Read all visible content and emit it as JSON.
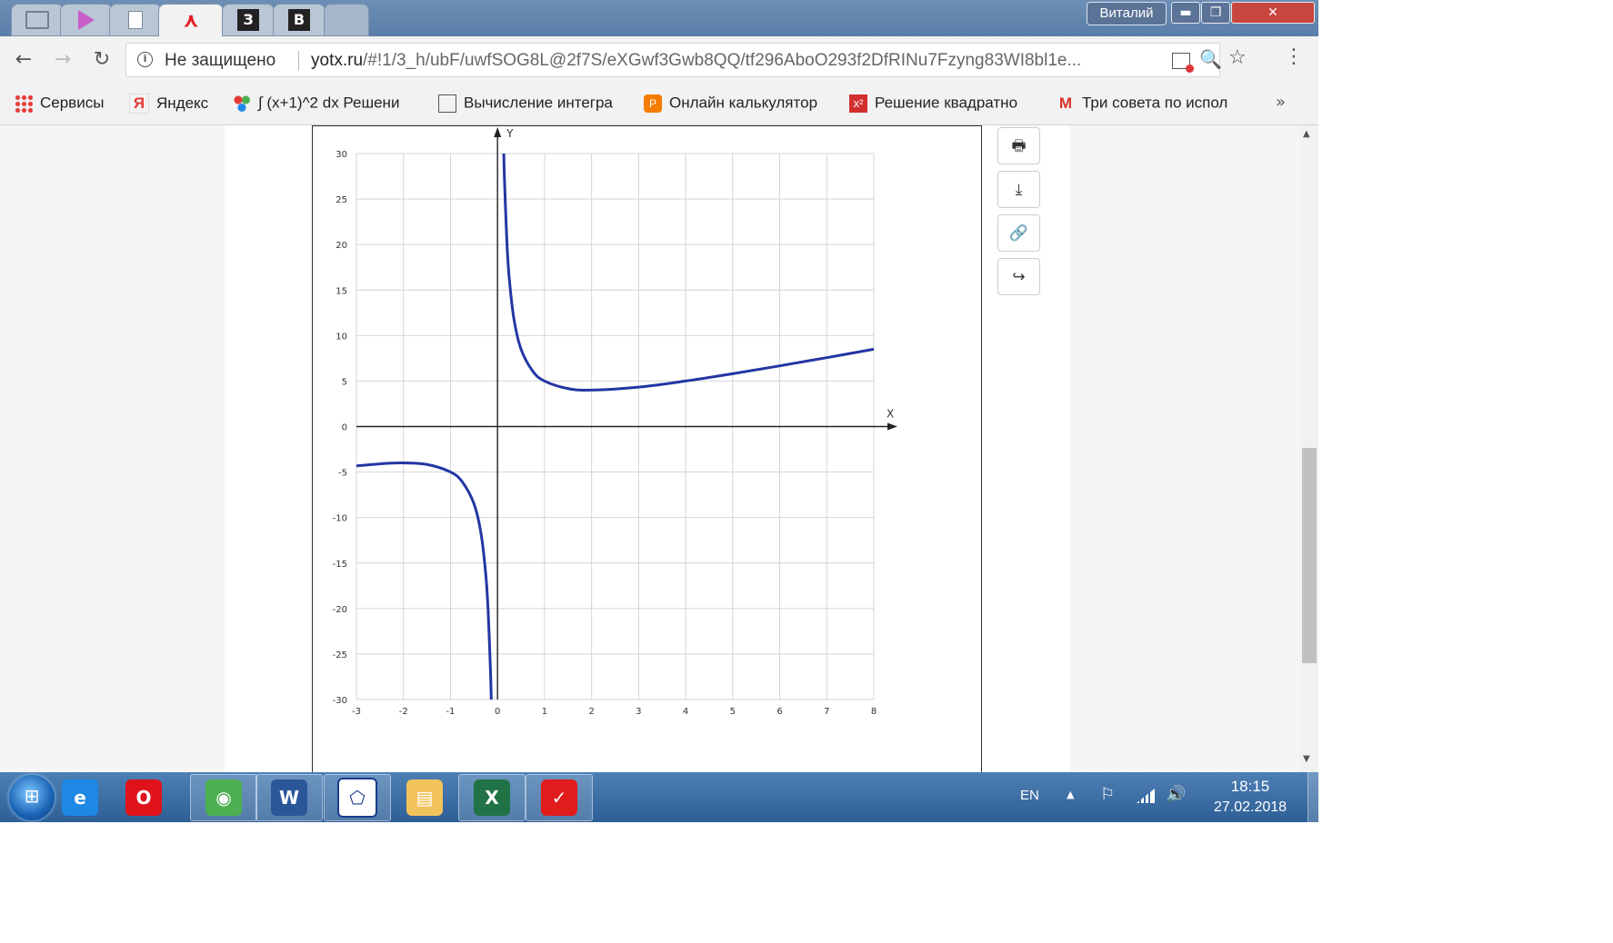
{
  "window": {
    "user_label": "Виталий",
    "minimize": "▬",
    "maximize": "❐",
    "close": "✕"
  },
  "tabs": [
    {
      "icon": "tv-icon"
    },
    {
      "icon": "play-icon"
    },
    {
      "icon": "document-icon"
    },
    {
      "icon": "yotx-icon",
      "active": true
    },
    {
      "icon": "letter-z-icon",
      "glyph": "З"
    },
    {
      "icon": "letter-v-icon",
      "glyph": "В"
    },
    {
      "icon": "new-tab-icon"
    }
  ],
  "toolbar": {
    "back": "←",
    "forward": "→",
    "reload": "↻",
    "security_text": "Не защищено",
    "url_host": "yotx.ru",
    "url_path": "/#!1/3_h/ubF/uwfSOG8L@2f7S/eXGwf3Gwb8QQ/tf296AboO293f2DfRINu7Fzyng83WI8bl1e...",
    "zoom_icon": "🔍",
    "star_icon": "☆",
    "menu_icon": "⋮"
  },
  "bookmarks": [
    {
      "label": "Сервисы",
      "icon": "apps-icon"
    },
    {
      "label": "Яндекс",
      "icon": "yandex-icon"
    },
    {
      "label": "∫ (x+1)^2 dx Решени",
      "icon": "circles-icon"
    },
    {
      "label": "Вычисление интегра",
      "icon": "blank-page-icon"
    },
    {
      "label": "Онлайн калькулятор",
      "icon": "calculator-icon"
    },
    {
      "label": "Решение квадратно",
      "icon": "x-squared-icon"
    },
    {
      "label": "Три совета по испол",
      "icon": "gmail-icon"
    }
  ],
  "bookmarks_more": "»",
  "side_buttons": [
    {
      "name": "print-button",
      "icon": "🖶"
    },
    {
      "name": "download-button",
      "icon": "⤓"
    },
    {
      "name": "link-button",
      "icon": "🔗"
    },
    {
      "name": "share-button",
      "icon": "↪"
    }
  ],
  "chart_data": {
    "type": "line",
    "title": "",
    "xlabel": "X",
    "ylabel": "Y",
    "xlim": [
      -3,
      8
    ],
    "ylim": [
      -30,
      30
    ],
    "x_ticks": [
      -3,
      -2,
      -1,
      0,
      1,
      2,
      3,
      4,
      5,
      6,
      7,
      8
    ],
    "y_ticks": [
      30,
      25,
      20,
      15,
      10,
      5,
      0,
      -5,
      -10,
      -15,
      -20,
      -25,
      -30
    ],
    "grid": true,
    "line_color": "#2336a3",
    "series": [
      {
        "x": [
          -3,
          -2.5,
          -2,
          -1.5,
          -1,
          -0.75,
          -0.5,
          -0.35,
          -0.25,
          -0.2,
          -0.15,
          -0.133
        ],
        "y": [
          -4.33,
          -4.1,
          -4.0,
          -4.17,
          -5.0,
          -6.08,
          -8.5,
          -11.78,
          -16.25,
          -20.2,
          -26.8,
          -30
        ]
      },
      {
        "x": [
          0.133,
          0.15,
          0.2,
          0.25,
          0.35,
          0.5,
          0.75,
          1,
          1.5,
          2,
          3,
          4,
          5,
          6,
          7,
          8
        ],
        "y": [
          30,
          26.8,
          20.2,
          16.25,
          11.78,
          8.5,
          6.08,
          5.0,
          4.17,
          4.0,
          4.33,
          5.0,
          5.8,
          6.67,
          7.57,
          8.5
        ]
      }
    ]
  },
  "taskbar": {
    "apps": [
      {
        "name": "ie-icon",
        "glyph": "e",
        "color": "#1e88e5",
        "open": false
      },
      {
        "name": "opera-icon",
        "glyph": "O",
        "color": "#e0131b",
        "open": false
      },
      {
        "name": "chrome-icon",
        "glyph": "◉",
        "color": "#4caf50",
        "open": true
      },
      {
        "name": "word-icon",
        "glyph": "W",
        "color": "#2b579a",
        "open": true
      },
      {
        "name": "geogebra-icon",
        "glyph": "⬠",
        "color": "#ffffff",
        "open": true
      },
      {
        "name": "explorer-icon",
        "glyph": "▤",
        "color": "#f3c35b",
        "open": false
      },
      {
        "name": "excel-icon",
        "glyph": "X",
        "color": "#217346",
        "open": true
      },
      {
        "name": "red-app-icon",
        "glyph": "✓",
        "color": "#e01c1c",
        "open": true
      }
    ],
    "language": "EN",
    "tray_arrow": "▲",
    "flag_icon": "⚐",
    "network_icon": "▮",
    "volume_icon": "🔊",
    "time": "18:15",
    "date": "27.02.2018"
  }
}
